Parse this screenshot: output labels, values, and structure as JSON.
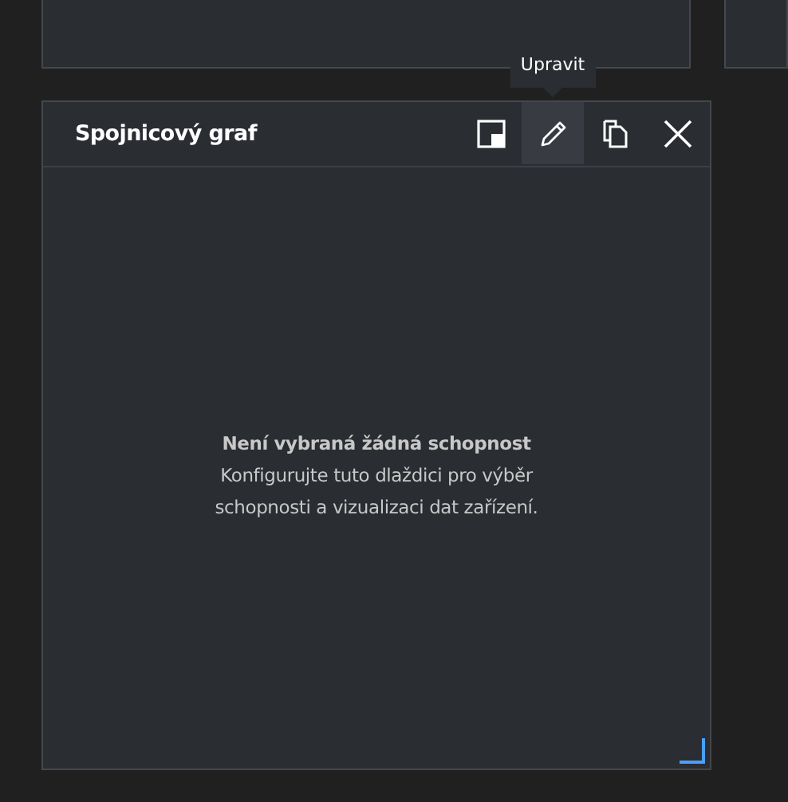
{
  "tile": {
    "title": "Spojnicový graf",
    "actions": [
      {
        "kind": "resize",
        "selected": false
      },
      {
        "kind": "edit",
        "selected": true
      },
      {
        "kind": "copy",
        "selected": false
      },
      {
        "kind": "close",
        "selected": false
      }
    ],
    "tooltip": "Upravit",
    "empty_state": {
      "heading": "Není vybraná žádná schopnost",
      "message": "Konfigurujte tuto dlaždici pro výběr schopnosti a vizualizaci dat zařízení."
    }
  }
}
